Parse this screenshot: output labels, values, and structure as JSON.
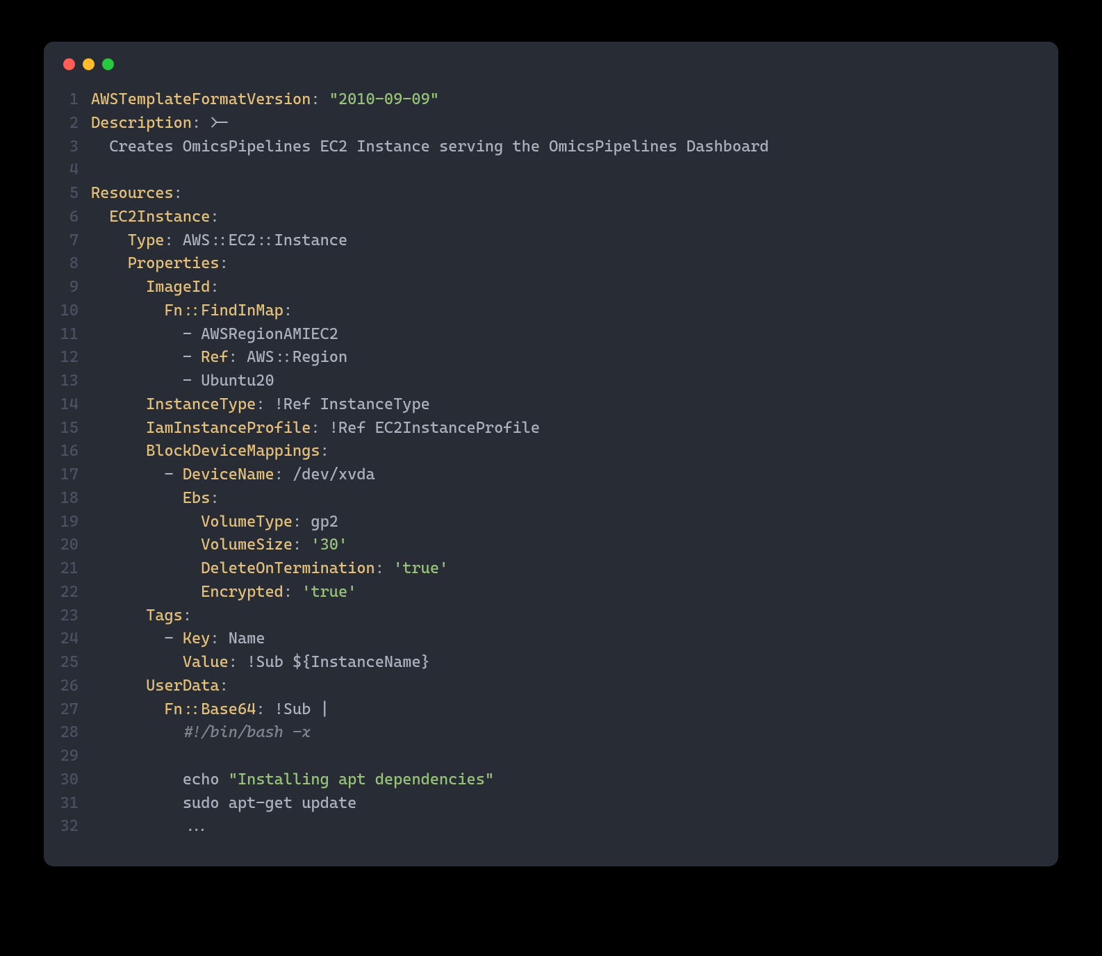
{
  "lines": [
    {
      "n": "1",
      "tokens": [
        {
          "cls": "key",
          "t": "AWSTemplateFormatVersion"
        },
        {
          "cls": "punct",
          "t": ": "
        },
        {
          "cls": "str",
          "t": "\"2010-09-09\""
        }
      ]
    },
    {
      "n": "2",
      "tokens": [
        {
          "cls": "key",
          "t": "Description"
        },
        {
          "cls": "punct",
          "t": ": "
        },
        {
          "cls": "plain",
          "t": ">-"
        }
      ]
    },
    {
      "n": "3",
      "tokens": [
        {
          "cls": "plain",
          "t": "  Creates OmicsPipelines EC2 Instance serving the OmicsPipelines Dashboard"
        }
      ]
    },
    {
      "n": "4",
      "tokens": []
    },
    {
      "n": "5",
      "tokens": [
        {
          "cls": "key",
          "t": "Resources"
        },
        {
          "cls": "punct",
          "t": ":"
        }
      ]
    },
    {
      "n": "6",
      "tokens": [
        {
          "cls": "plain",
          "t": "  "
        },
        {
          "cls": "key",
          "t": "EC2Instance"
        },
        {
          "cls": "punct",
          "t": ":"
        }
      ]
    },
    {
      "n": "7",
      "tokens": [
        {
          "cls": "plain",
          "t": "    "
        },
        {
          "cls": "key",
          "t": "Type"
        },
        {
          "cls": "punct",
          "t": ": "
        },
        {
          "cls": "plain",
          "t": "AWS::EC2::Instance"
        }
      ]
    },
    {
      "n": "8",
      "tokens": [
        {
          "cls": "plain",
          "t": "    "
        },
        {
          "cls": "key",
          "t": "Properties"
        },
        {
          "cls": "punct",
          "t": ":"
        }
      ]
    },
    {
      "n": "9",
      "tokens": [
        {
          "cls": "plain",
          "t": "      "
        },
        {
          "cls": "key",
          "t": "ImageId"
        },
        {
          "cls": "punct",
          "t": ":"
        }
      ]
    },
    {
      "n": "10",
      "tokens": [
        {
          "cls": "plain",
          "t": "        "
        },
        {
          "cls": "key",
          "t": "Fn::FindInMap"
        },
        {
          "cls": "punct",
          "t": ":"
        }
      ]
    },
    {
      "n": "11",
      "tokens": [
        {
          "cls": "plain",
          "t": "          - AWSRegionAMIEC2"
        }
      ]
    },
    {
      "n": "12",
      "tokens": [
        {
          "cls": "plain",
          "t": "          - "
        },
        {
          "cls": "key",
          "t": "Ref"
        },
        {
          "cls": "punct",
          "t": ": "
        },
        {
          "cls": "plain",
          "t": "AWS::Region"
        }
      ]
    },
    {
      "n": "13",
      "tokens": [
        {
          "cls": "plain",
          "t": "          - Ubuntu20"
        }
      ]
    },
    {
      "n": "14",
      "tokens": [
        {
          "cls": "plain",
          "t": "      "
        },
        {
          "cls": "key",
          "t": "InstanceType"
        },
        {
          "cls": "punct",
          "t": ": "
        },
        {
          "cls": "plain",
          "t": "!Ref InstanceType"
        }
      ]
    },
    {
      "n": "15",
      "tokens": [
        {
          "cls": "plain",
          "t": "      "
        },
        {
          "cls": "key",
          "t": "IamInstanceProfile"
        },
        {
          "cls": "punct",
          "t": ": "
        },
        {
          "cls": "plain",
          "t": "!Ref EC2InstanceProfile"
        }
      ]
    },
    {
      "n": "16",
      "tokens": [
        {
          "cls": "plain",
          "t": "      "
        },
        {
          "cls": "key",
          "t": "BlockDeviceMappings"
        },
        {
          "cls": "punct",
          "t": ":"
        }
      ]
    },
    {
      "n": "17",
      "tokens": [
        {
          "cls": "plain",
          "t": "        - "
        },
        {
          "cls": "key",
          "t": "DeviceName"
        },
        {
          "cls": "punct",
          "t": ": "
        },
        {
          "cls": "plain",
          "t": "/dev/xvda"
        }
      ]
    },
    {
      "n": "18",
      "tokens": [
        {
          "cls": "plain",
          "t": "          "
        },
        {
          "cls": "key",
          "t": "Ebs"
        },
        {
          "cls": "punct",
          "t": ":"
        }
      ]
    },
    {
      "n": "19",
      "tokens": [
        {
          "cls": "plain",
          "t": "            "
        },
        {
          "cls": "key",
          "t": "VolumeType"
        },
        {
          "cls": "punct",
          "t": ": "
        },
        {
          "cls": "plain",
          "t": "gp2"
        }
      ]
    },
    {
      "n": "20",
      "tokens": [
        {
          "cls": "plain",
          "t": "            "
        },
        {
          "cls": "key",
          "t": "VolumeSize"
        },
        {
          "cls": "punct",
          "t": ": "
        },
        {
          "cls": "str",
          "t": "'30'"
        }
      ]
    },
    {
      "n": "21",
      "tokens": [
        {
          "cls": "plain",
          "t": "            "
        },
        {
          "cls": "key",
          "t": "DeleteOnTermination"
        },
        {
          "cls": "punct",
          "t": ": "
        },
        {
          "cls": "str",
          "t": "'true'"
        }
      ]
    },
    {
      "n": "22",
      "tokens": [
        {
          "cls": "plain",
          "t": "            "
        },
        {
          "cls": "key",
          "t": "Encrypted"
        },
        {
          "cls": "punct",
          "t": ": "
        },
        {
          "cls": "str",
          "t": "'true'"
        }
      ]
    },
    {
      "n": "23",
      "tokens": [
        {
          "cls": "plain",
          "t": "      "
        },
        {
          "cls": "key",
          "t": "Tags"
        },
        {
          "cls": "punct",
          "t": ":"
        }
      ]
    },
    {
      "n": "24",
      "tokens": [
        {
          "cls": "plain",
          "t": "        - "
        },
        {
          "cls": "key",
          "t": "Key"
        },
        {
          "cls": "punct",
          "t": ": "
        },
        {
          "cls": "plain",
          "t": "Name"
        }
      ]
    },
    {
      "n": "25",
      "tokens": [
        {
          "cls": "plain",
          "t": "          "
        },
        {
          "cls": "key",
          "t": "Value"
        },
        {
          "cls": "punct",
          "t": ": "
        },
        {
          "cls": "plain",
          "t": "!Sub ${InstanceName}"
        }
      ]
    },
    {
      "n": "26",
      "tokens": [
        {
          "cls": "plain",
          "t": "      "
        },
        {
          "cls": "key",
          "t": "UserData"
        },
        {
          "cls": "punct",
          "t": ":"
        }
      ]
    },
    {
      "n": "27",
      "tokens": [
        {
          "cls": "plain",
          "t": "        "
        },
        {
          "cls": "key",
          "t": "Fn::Base64"
        },
        {
          "cls": "punct",
          "t": ": "
        },
        {
          "cls": "plain",
          "t": "!Sub |"
        }
      ]
    },
    {
      "n": "28",
      "tokens": [
        {
          "cls": "plain",
          "t": "          "
        },
        {
          "cls": "comment",
          "t": "#!/bin/bash -x"
        }
      ]
    },
    {
      "n": "29",
      "tokens": []
    },
    {
      "n": "30",
      "tokens": [
        {
          "cls": "plain",
          "t": "          echo "
        },
        {
          "cls": "str",
          "t": "\"Installing apt dependencies\""
        }
      ]
    },
    {
      "n": "31",
      "tokens": [
        {
          "cls": "plain",
          "t": "          sudo apt-get update"
        }
      ]
    },
    {
      "n": "32",
      "tokens": [
        {
          "cls": "plain",
          "t": "          ..."
        }
      ]
    }
  ]
}
